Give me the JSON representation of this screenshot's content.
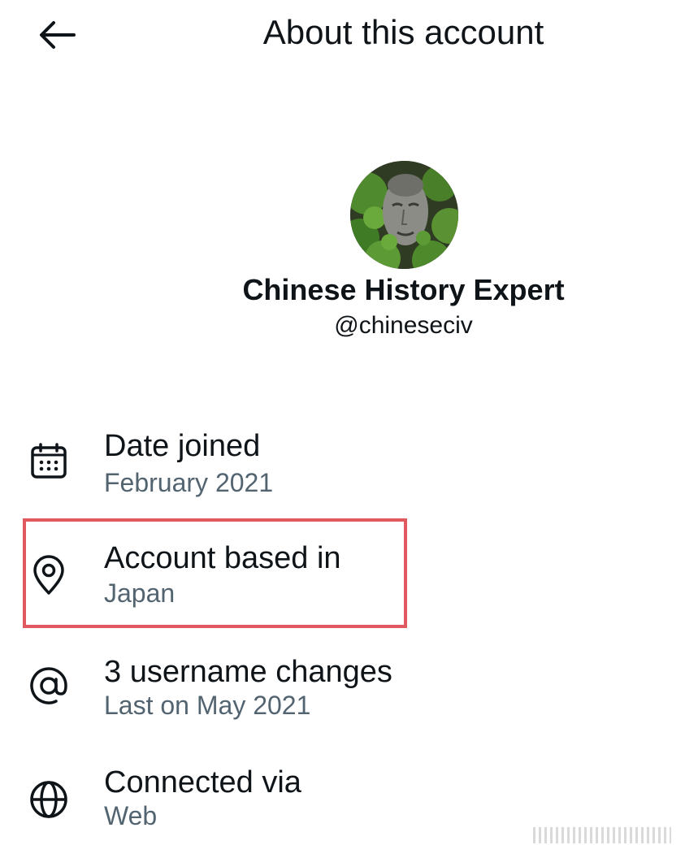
{
  "header": {
    "title": "About this account"
  },
  "profile": {
    "display_name": "Chinese History Expert",
    "handle": "@chineseciv"
  },
  "rows": [
    {
      "icon": "calendar-icon",
      "title": "Date joined",
      "subtitle": "February 2021"
    },
    {
      "icon": "location-pin-icon",
      "title": "Account based in",
      "subtitle": "Japan"
    },
    {
      "icon": "at-sign-icon",
      "title": "3 username changes",
      "subtitle": "Last on May 2021"
    },
    {
      "icon": "globe-icon",
      "title": "Connected via",
      "subtitle": "Web"
    }
  ],
  "colors": {
    "text_primary": "#0f1419",
    "text_secondary": "#536471",
    "highlight_border": "#e0595e",
    "background": "#ffffff"
  }
}
